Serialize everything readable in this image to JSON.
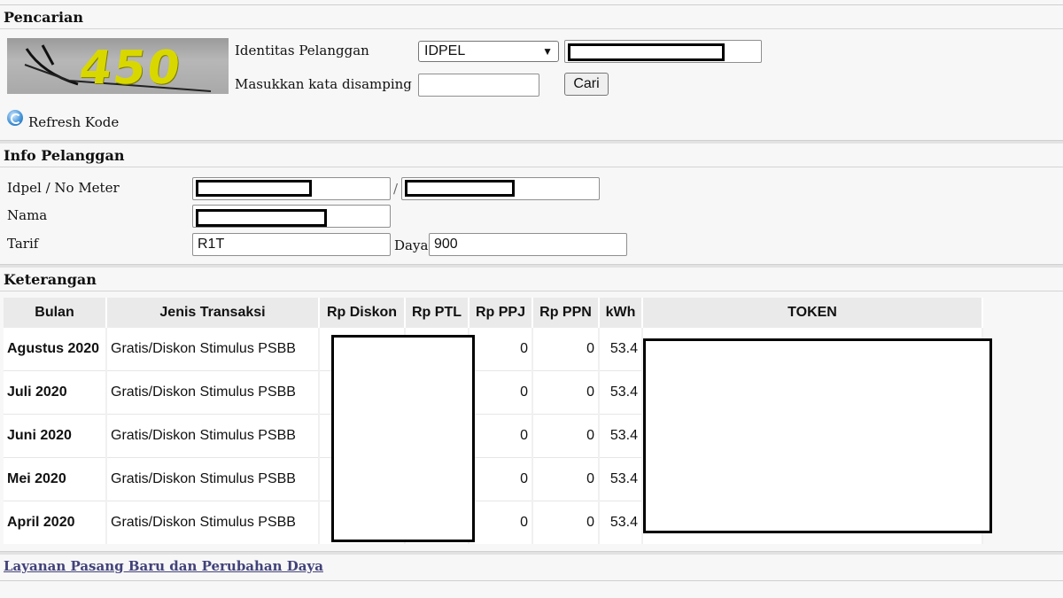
{
  "pencarian": {
    "title": "Pencarian",
    "captcha_code": "450",
    "identitas_label": "Identitas Pelanggan",
    "identitas_select": "IDPEL",
    "kata_label": "Masukkan kata disamping",
    "cari_button": "Cari",
    "refresh_label": "Refresh Kode"
  },
  "info": {
    "title": "Info Pelanggan",
    "idpel_label": "Idpel / No Meter",
    "separator": "/",
    "nama_label": "Nama",
    "tarif_label": "Tarif",
    "tarif_value": "R1T",
    "daya_label": "Daya",
    "daya_value": "900"
  },
  "keterangan": {
    "title": "Keterangan",
    "columns": [
      "Bulan",
      "Jenis Transaksi",
      "Rp Diskon",
      "Rp PTL",
      "Rp PPJ",
      "Rp PPN",
      "kWh",
      "TOKEN"
    ],
    "rows": [
      {
        "bulan": "Agustus 2020",
        "jenis": "Gratis/Diskon Stimulus PSBB",
        "ppj": "0",
        "ppn": "0",
        "kwh": "53.4"
      },
      {
        "bulan": "Juli 2020",
        "jenis": "Gratis/Diskon Stimulus PSBB",
        "ppj": "0",
        "ppn": "0",
        "kwh": "53.4"
      },
      {
        "bulan": "Juni 2020",
        "jenis": "Gratis/Diskon Stimulus PSBB",
        "ppj": "0",
        "ppn": "0",
        "kwh": "53.4"
      },
      {
        "bulan": "Mei 2020",
        "jenis": "Gratis/Diskon Stimulus PSBB",
        "ppj": "0",
        "ppn": "0",
        "kwh": "53.4"
      },
      {
        "bulan": "April 2020",
        "jenis": "Gratis/Diskon Stimulus PSBB",
        "ppj": "0",
        "ppn": "0",
        "kwh": "53.4"
      }
    ]
  },
  "footer": {
    "link": "Layanan Pasang Baru dan Perubahan Daya"
  }
}
